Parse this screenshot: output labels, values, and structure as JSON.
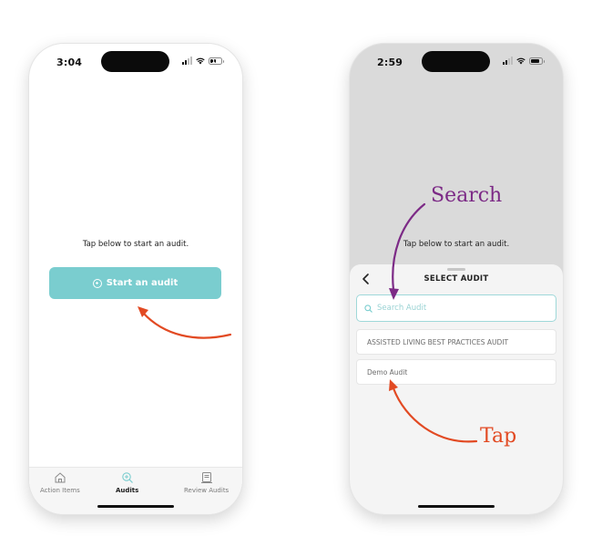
{
  "screen_left": {
    "status": {
      "time": "3:04",
      "battery": "17"
    },
    "prompt": "Tap below to start an audit.",
    "start_button_label": "Start an audit",
    "tabs": [
      {
        "label": "Action Items",
        "icon": "home-icon",
        "active": false
      },
      {
        "label": "Audits",
        "icon": "search-plus-icon",
        "active": true
      },
      {
        "label": "Review Audits",
        "icon": "review-icon",
        "active": false
      }
    ]
  },
  "screen_right": {
    "status": {
      "time": "2:59",
      "battery": ""
    },
    "prompt": "Tap below to start an audit.",
    "sheet": {
      "title": "SELECT AUDIT",
      "search_placeholder": "Search Audit",
      "audits": [
        "ASSISTED LIVING BEST PRACTICES AUDIT",
        "Demo Audit"
      ]
    }
  },
  "annotations": {
    "search": "Search",
    "tap": "Tap"
  },
  "colors": {
    "accent": "#7acdcf",
    "search_arrow": "#7c2a86",
    "tap_arrow": "#e24a23"
  }
}
